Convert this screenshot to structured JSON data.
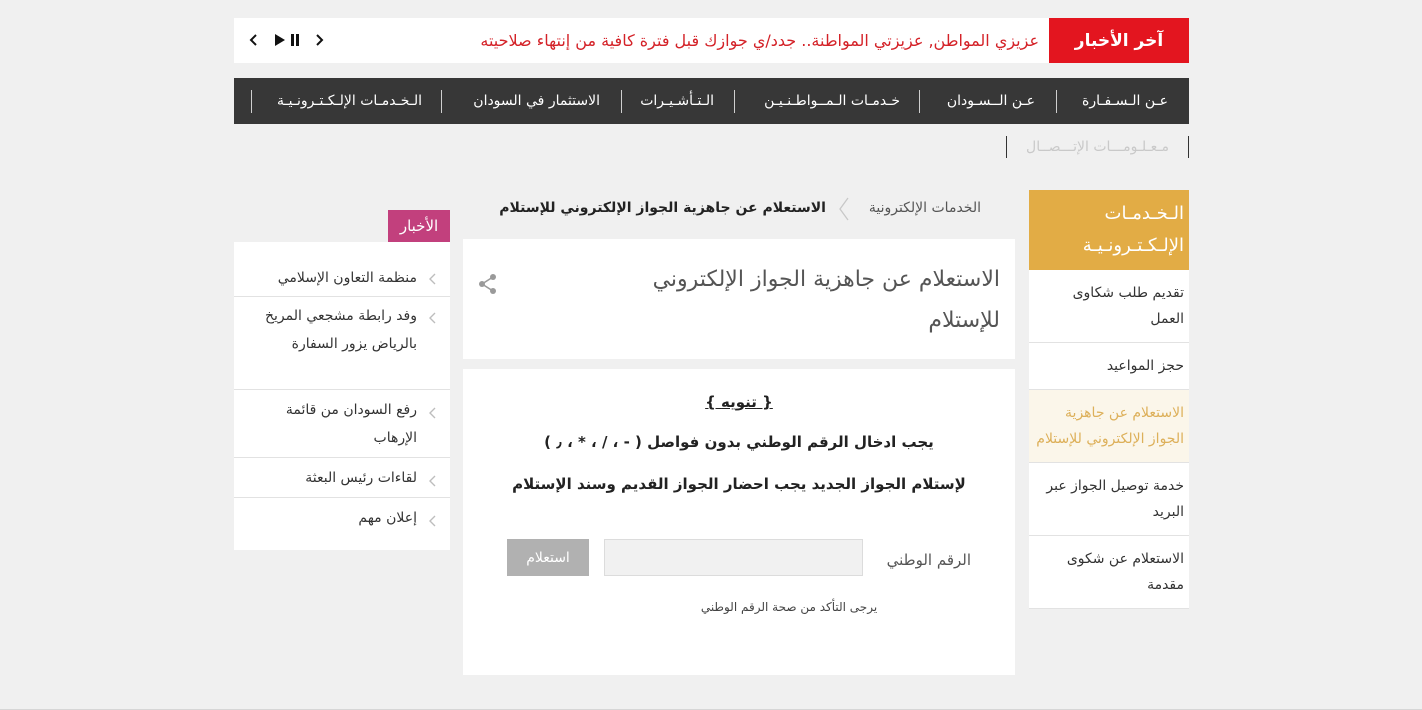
{
  "ticker": {
    "label": "آخر الأخبار",
    "text": "عزيزي المواطن, عزيزتي المواطنة.. جدد/ي جوازك قبل فترة كافية من إنتهاء صلاحيته"
  },
  "nav": {
    "items": [
      "عـن الـسـفـارة",
      "عـن الــسـودان",
      "خـدمـات الـمــواطـنـيـن",
      "الـتـأشـيـرات",
      "الاستثمار في السودان",
      "الـخـدمـات الإلـكـتـرونـيـة"
    ],
    "sub_item": "مـعـلـومـــات الإتـــصــال"
  },
  "sidebar": {
    "title": "الـخـدمـات الإلـكـتـرونـيـة",
    "items": [
      "تقديم طلب شكاوى العمل",
      "حجز المواعيد",
      "الاستعلام عن جاهزية الجواز الإلكتروني للإستلام",
      "خدمة توصيل الجواز عبر البريد",
      "الاستعلام عن شكوى مقدمة"
    ]
  },
  "breadcrumb": {
    "parent": "الخدمات الإلكترونية",
    "current": "الاستعلام عن جاهزية الجواز الإلكتروني للإستلام"
  },
  "page": {
    "title": "الاستعلام عن جاهزية الجواز الإلكتروني للإستلام"
  },
  "content": {
    "notice": "{  تنويه  }",
    "line1": "يجب ادخال الرقم الوطني بدون فواصل ( - ، / ، * ، ٫ )",
    "line2": "لإستلام الجواز الجديد يجب احضار الجواز القديم  وسند الإستلام",
    "field_label": "الرقم الوطني",
    "field_value": "",
    "button": "استعلام",
    "hint": "يرجى التأكد من صحة الرقم الوطني"
  },
  "news": {
    "title": "الأخبار",
    "items": [
      "منظمة التعاون الإسلامي",
      "وفد رابطة مشجعي المريخ بالرياض يزور السفارة",
      "رفع السودان من قائمة الإرهاب",
      "لقاءات رئيس البعثة",
      "إعلان مهم"
    ]
  },
  "colors": {
    "ticker_label": "#e3151f",
    "ticker_text": "#d42228",
    "nav_bg": "#373737",
    "sidebar_head": "#e2ac45",
    "sidebar_active": "#ddb05a",
    "news_tag": "#c2407d",
    "button": "#b1b1b1"
  },
  "icons": [
    "pause-icon",
    "play-icon",
    "chevron-left-icon",
    "chevron-right-icon",
    "share-icon"
  ]
}
